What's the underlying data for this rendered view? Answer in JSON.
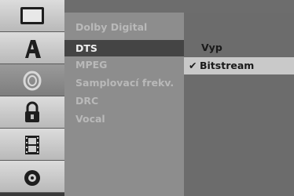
{
  "menu": {
    "items": [
      {
        "label": "Dolby Digital"
      },
      {
        "label": "DTS"
      },
      {
        "label": "MPEG"
      },
      {
        "label": "Samplovací frekv."
      },
      {
        "label": "DRC"
      },
      {
        "label": "Vocal"
      }
    ],
    "selected_index": 1
  },
  "options": {
    "items": [
      {
        "label": "Vyp",
        "checked": false
      },
      {
        "label": "Bitstream",
        "checked": true
      }
    ],
    "check_glyph": "✔"
  },
  "rail": {
    "icons": [
      "tv-icon",
      "font-a-icon",
      "audio-disc-icon",
      "lock-icon",
      "film-icon",
      "disc-icon"
    ],
    "active_index": 2
  },
  "colors": {
    "selected_bg": "#444444",
    "checked_bg": "#c9c9c9"
  }
}
